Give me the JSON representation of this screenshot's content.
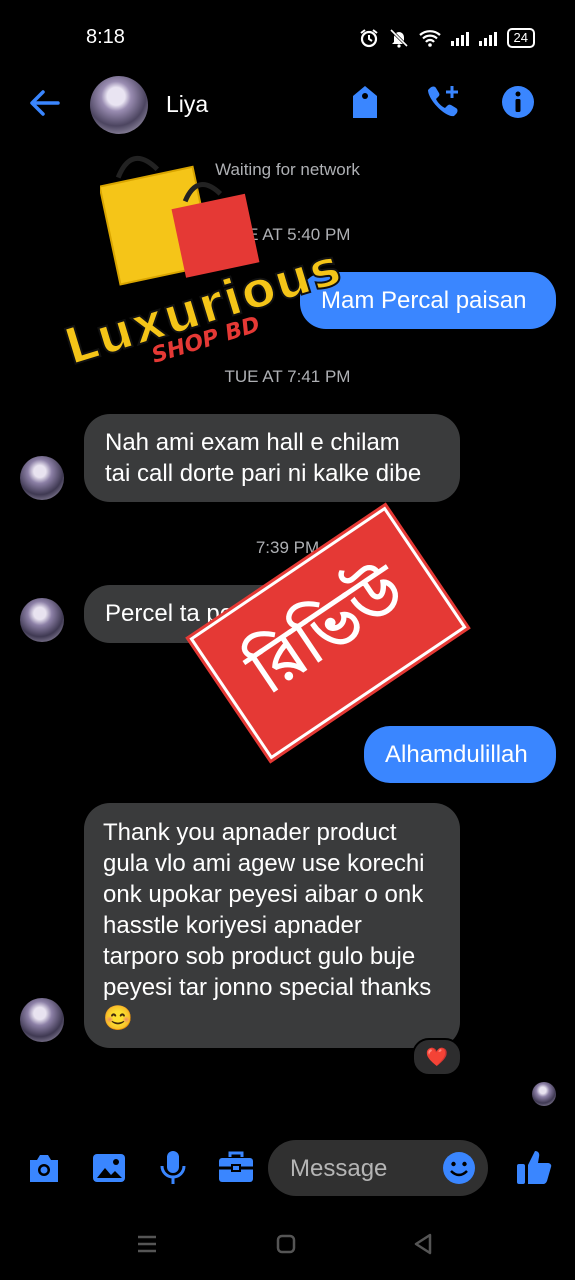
{
  "status_bar": {
    "time": "8:18",
    "battery": "24"
  },
  "header": {
    "contact_name": "Liya"
  },
  "messages": {
    "network_status": "Waiting for network",
    "ts_1": "TUE AT 5:40 PM",
    "out_1": "Mam Percal paisan",
    "ts_2": "TUE AT 7:41 PM",
    "in_1_line1": "Nah ami exam hall e chilam",
    "in_1_line2": "tai call dorte pari ni kalke dibe",
    "ts_3": "7:39 PM",
    "in_2": "Percel ta peyesi",
    "out_2": "Alhamdulillah",
    "in_3": "Thank you apnader product gula vlo ami agew use korechi onk upokar peyesi aibar o onk hasstle koriyesi apnader tarporo sob product gulo buje peyesi tar jonno special thanks😊",
    "reaction": "❤️"
  },
  "watermark": {
    "brand": "Luxurious",
    "sub": "SHOP BD"
  },
  "stamp": {
    "text": "রিভিউ"
  },
  "composer": {
    "placeholder": "Message"
  },
  "colors": {
    "accent": "#3a86ff",
    "incoming_bubble": "#3a3b3c",
    "outgoing_bubble": "#3a86ff",
    "stamp_red": "#e53935",
    "brand_yellow": "#f5c518"
  }
}
